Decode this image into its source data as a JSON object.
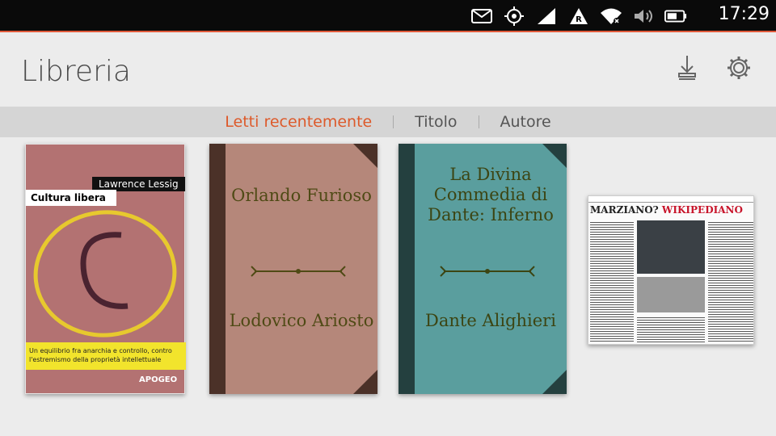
{
  "status": {
    "time": "17:29",
    "icons": [
      "mail-icon",
      "location-icon",
      "signal-icon",
      "roaming-icon",
      "wifi-icon",
      "volume-icon",
      "battery-icon"
    ]
  },
  "header": {
    "title": "Libreria",
    "download_icon": "download-icon",
    "settings_icon": "settings-icon"
  },
  "tabs": [
    {
      "label": "Letti recentemente",
      "active": true
    },
    {
      "label": "Titolo",
      "active": false
    },
    {
      "label": "Autore",
      "active": false
    }
  ],
  "books": [
    {
      "author": "Lawrence Lessig",
      "title": "Cultura libera",
      "subtitle": "Un equilibrio fra anarchia e controllo, contro l'estremismo della proprietà intellettuale",
      "publisher": "APOGEO"
    },
    {
      "title": "Orlando Furioso",
      "author": "Lodovico Ariosto"
    },
    {
      "title": "La Divina Commedia di Dante: Inferno",
      "author": "Dante Alighieri"
    },
    {
      "headline_a": "MARZIANO?",
      "headline_b": "WIKIPEDIANO"
    }
  ],
  "colors": {
    "accent": "#dd5a2b"
  }
}
